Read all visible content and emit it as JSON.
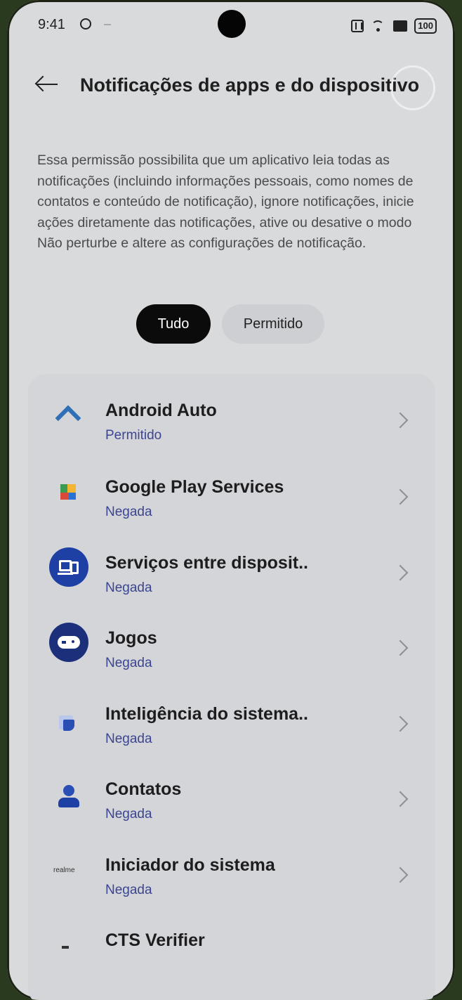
{
  "status_bar": {
    "time": "9:41",
    "battery": "100",
    "icons": [
      "dnd-icon",
      "nfc-icon",
      "wifi-icon",
      "sim-icon",
      "battery-icon"
    ]
  },
  "header": {
    "title": "Notificações de apps e do dispositivo",
    "back_icon": "arrow-left-icon"
  },
  "description": "Essa permissão possibilita que um aplicativo leia todas as notificações (incluindo informações pessoais, como nomes de contatos e conteúdo de notificação), ignore notificações, inicie ações diretamente das notificações, ative ou desative o modo Não perturbe e altere as configurações de notificação.",
  "filters": {
    "all": "Tudo",
    "allowed": "Permitido",
    "selected": "Tudo"
  },
  "apps": [
    {
      "name": "Android Auto",
      "status": "Permitido",
      "icon": "android-auto-icon"
    },
    {
      "name": "Google Play Services",
      "status": "Negada",
      "icon": "google-play-services-icon"
    },
    {
      "name": "Serviços entre disposit..",
      "status": "Negada",
      "icon": "cross-device-icon"
    },
    {
      "name": "Jogos",
      "status": "Negada",
      "icon": "gamepad-icon"
    },
    {
      "name": "Inteligência do sistema..",
      "status": "Negada",
      "icon": "system-intelligence-icon"
    },
    {
      "name": "Contatos",
      "status": "Negada",
      "icon": "contacts-icon"
    },
    {
      "name": "Iniciador do sistema",
      "status": "Negada",
      "icon": "realme-launcher-icon",
      "icon_text": "realme"
    },
    {
      "name": "CTS Verifier",
      "status": "",
      "icon": "cts-verifier-icon"
    }
  ]
}
